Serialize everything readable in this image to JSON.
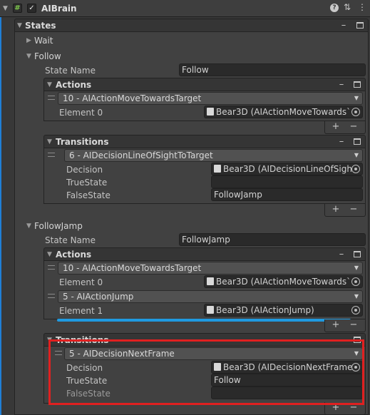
{
  "component": {
    "title": "AIBrain",
    "enabled_mark": "✓",
    "script_icon_glyph": "#"
  },
  "states_label": "States",
  "states": {
    "wait": {
      "label": "Wait"
    },
    "follow": {
      "label": "Follow",
      "state_name_label": "State Name",
      "state_name_value": "Follow",
      "actions": {
        "label": "Actions",
        "items": [
          {
            "dropdown": "10 - AIActionMoveTowardsTarget",
            "element_label": "Element 0",
            "object_value": "Bear3D (AIActionMoveTowards`"
          }
        ]
      },
      "transitions": {
        "label": "Transitions",
        "items": [
          {
            "dropdown": "6 - AIDecisionLineOfSightToTarget",
            "decision_label": "Decision",
            "decision_value": "Bear3D (AIDecisionLineOfSigh",
            "true_label": "TrueState",
            "true_value": "",
            "false_label": "FalseState",
            "false_value": "FollowJamp"
          }
        ]
      }
    },
    "followjamp": {
      "label": "FollowJamp",
      "state_name_label": "State Name",
      "state_name_value": "FollowJamp",
      "actions": {
        "label": "Actions",
        "items": [
          {
            "dropdown": "10 - AIActionMoveTowardsTarget",
            "element_label": "Element 0",
            "object_value": "Bear3D (AIActionMoveTowards`"
          },
          {
            "dropdown": "5 - AIActionJump",
            "element_label": "Element 1",
            "object_value": "Bear3D (AIActionJump)"
          }
        ]
      },
      "transitions": {
        "label": "Transitions",
        "items": [
          {
            "dropdown": "5 - AIDecisionNextFrame",
            "decision_label": "Decision",
            "decision_value": "Bear3D (AIDecisionNextFrame",
            "true_label": "TrueState",
            "true_value": "Follow",
            "false_label": "FalseState",
            "false_value": ""
          }
        ]
      }
    }
  },
  "controls": {
    "plus": "+",
    "minus": "−",
    "collapse": "–"
  },
  "colors": {
    "highlight_box": "#e02020",
    "drag_indicator": "#1f9ae0",
    "left_strip": "#1f7fd6"
  }
}
